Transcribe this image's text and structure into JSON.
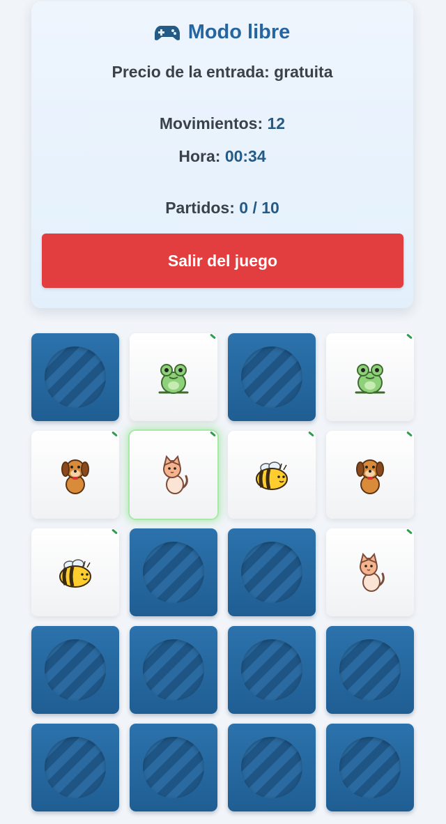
{
  "header": {
    "title": "Modo libre",
    "icon": "gamepad-icon",
    "entry_price": "Precio de la entrada: gratuita"
  },
  "stats": {
    "moves_label": "Movimientos:",
    "moves_value": "12",
    "time_label": "Hora:",
    "time_value": "00:34",
    "pairs_label": "Partidos:",
    "pairs_value": "0 / 10"
  },
  "exit_button": {
    "label": "Salir del juego"
  },
  "colors": {
    "accent": "#2565a0",
    "card_back": "#2c72ac",
    "exit": "#e23d3f",
    "selected_glow": "#a8e9a8"
  },
  "board": {
    "columns": 4,
    "rows": 5,
    "cards": [
      {
        "state": "down",
        "animal": null
      },
      {
        "state": "up",
        "animal": "frog"
      },
      {
        "state": "down",
        "animal": null
      },
      {
        "state": "up",
        "animal": "frog"
      },
      {
        "state": "up",
        "animal": "dog"
      },
      {
        "state": "up",
        "animal": "cat",
        "selected": true
      },
      {
        "state": "up",
        "animal": "bee"
      },
      {
        "state": "up",
        "animal": "dog"
      },
      {
        "state": "up",
        "animal": "bee"
      },
      {
        "state": "down",
        "animal": null
      },
      {
        "state": "down",
        "animal": null
      },
      {
        "state": "up",
        "animal": "cat"
      },
      {
        "state": "down",
        "animal": null
      },
      {
        "state": "down",
        "animal": null
      },
      {
        "state": "down",
        "animal": null
      },
      {
        "state": "down",
        "animal": null
      },
      {
        "state": "down",
        "animal": null
      },
      {
        "state": "down",
        "animal": null
      },
      {
        "state": "down",
        "animal": null
      },
      {
        "state": "down",
        "animal": null
      }
    ]
  }
}
